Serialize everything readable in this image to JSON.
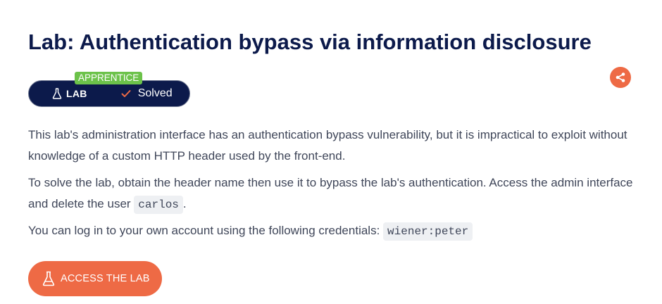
{
  "lab": {
    "title": "Lab: Authentication bypass via information disclosure",
    "level": "APPRENTICE",
    "type_label": "LAB",
    "status": "Solved"
  },
  "description": {
    "p1": "This lab's administration interface has an authentication bypass vulnerability, but it is impractical to exploit without knowledge of a custom HTTP header used by the front-end.",
    "p2_before": "To solve the lab, obtain the header name then use it to bypass the lab's authentication. Access the admin interface and delete the user ",
    "p2_code": "carlos",
    "p2_after": ".",
    "p3_before": "You can log in to your own account using the following credentials: ",
    "p3_code": "wiener:peter"
  },
  "actions": {
    "access_label": "ACCESS THE LAB"
  },
  "icons": {
    "share": "share-icon",
    "lab": "flask-icon",
    "solved": "checkmark-icon",
    "access": "flask-icon"
  },
  "colors": {
    "title": "#0c1a4b",
    "accent": "#ee6a45",
    "level_tag": "#6cc24a",
    "pill": "#0c1a4b",
    "body_text": "#3f4659",
    "code_bg": "#eef0f3"
  }
}
